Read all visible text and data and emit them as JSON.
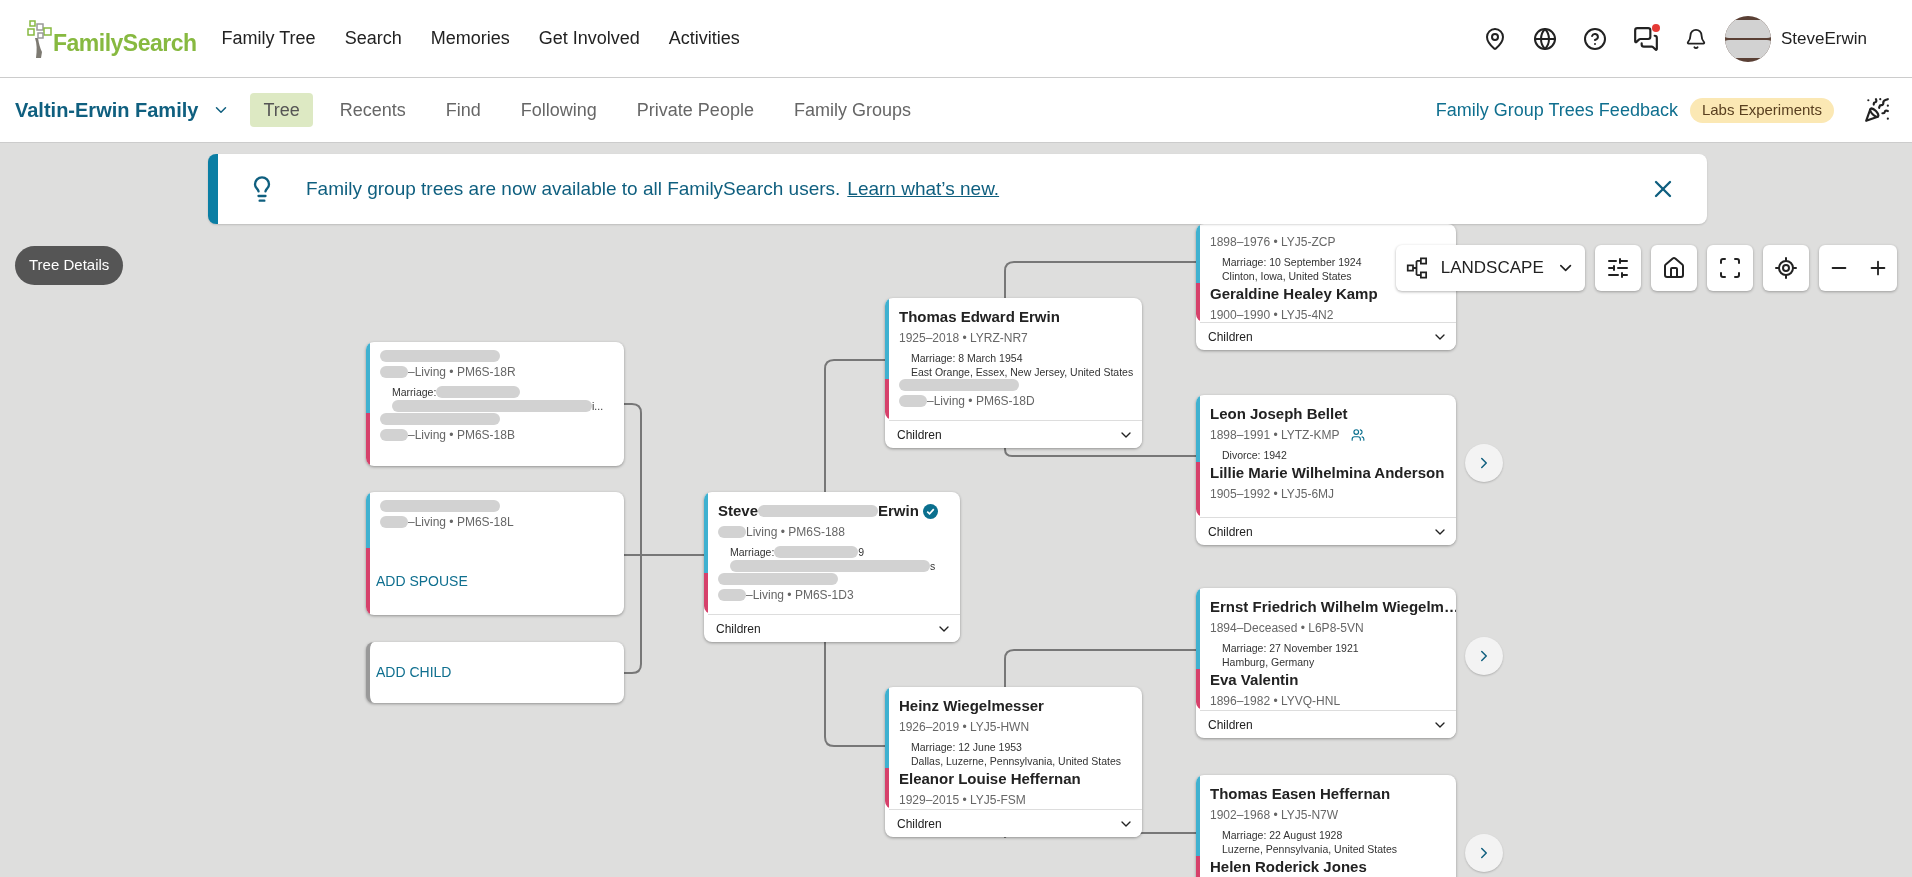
{
  "header": {
    "logo": "FamilySearch",
    "nav": [
      "Family Tree",
      "Search",
      "Memories",
      "Get Involved",
      "Activities"
    ],
    "messages_unread": true,
    "user": "SteveErwin"
  },
  "subnav": {
    "family": "Valtin-Erwin Family",
    "tabs": [
      {
        "label": "Tree",
        "selected": true
      },
      {
        "label": "Recents",
        "selected": false
      },
      {
        "label": "Find",
        "selected": false
      },
      {
        "label": "Following",
        "selected": false
      },
      {
        "label": "Private People",
        "selected": false
      },
      {
        "label": "Family Groups",
        "selected": false
      }
    ],
    "feedback_link": "Family Group Trees Feedback",
    "badge": "Labs Experiments"
  },
  "banner": {
    "text": "Family group trees are now available to all FamilySearch users.",
    "link": "Learn what’s new."
  },
  "tree_details": "Tree Details",
  "view_controls": {
    "layout": "LANDSCAPE"
  },
  "cards": [
    {
      "kind": "couple",
      "persons": [
        {
          "color": "#3fb1d0",
          "name": {
            "redacted": true
          },
          "lifespan": {
            "redacted": true,
            "tail": "–Living • PM6S-18R"
          }
        },
        {
          "color": "#d6416b",
          "name": {
            "redacted": true
          },
          "lifespan": {
            "redacted": true,
            "tail": "–Living • PM6S-18B"
          }
        }
      ],
      "event": {
        "text": "Marriage:",
        "redacted": true
      },
      "place": {
        "redacted": true,
        "tail": "i..."
      }
    },
    {
      "kind": "single",
      "persons": [
        {
          "color": "#3fb1d0",
          "name": {
            "redacted": true
          },
          "lifespan": {
            "redacted": true,
            "tail": "–Living • PM6S-18L"
          }
        }
      ],
      "add_spouse": "ADD SPOUSE"
    },
    {
      "kind": "add_child",
      "label": "ADD CHILD"
    },
    {
      "kind": "couple",
      "persons": [
        {
          "color": "#3fb1d0",
          "verified": true,
          "name": {
            "text": "Steve",
            "redacted": true,
            "tail": "Erwin"
          },
          "lifespan": {
            "redacted": true,
            "tail": "Living • PM6S-188"
          }
        },
        {
          "color": "#d6416b",
          "name": {
            "redacted": true
          },
          "lifespan": {
            "redacted": true,
            "tail": "–Living • PM6S-1D3"
          }
        }
      ],
      "event": {
        "text": "Marriage:",
        "redacted": true,
        "tail": "9"
      },
      "place": {
        "redacted": true,
        "tail": "s"
      },
      "children": "Children"
    },
    {
      "kind": "couple",
      "persons": [
        {
          "color": "#3fb1d0",
          "name": {
            "text": "Thomas Edward Erwin"
          },
          "lifespan": {
            "text": "1925–2018 • LYRZ-NR7"
          }
        },
        {
          "color": "#d6416b",
          "name": {
            "redacted": true
          },
          "lifespan": {
            "redacted": true,
            "tail": "–Living • PM6S-18D"
          }
        }
      ],
      "event": {
        "text": "Marriage: 8 March 1954"
      },
      "place": {
        "text": "East Orange, Essex, New Jersey, United States"
      },
      "children": "Children"
    },
    {
      "kind": "couple",
      "persons": [
        {
          "color": "#3fb1d0",
          "lifespan": {
            "text": "1898–1976 • LYJ5-ZCP"
          }
        },
        {
          "color": "#d6416b",
          "name": {
            "text": "Geraldine Healey Kamp"
          },
          "lifespan": {
            "text": "1900–1990 • LYJ5-4N2"
          }
        }
      ],
      "event": {
        "text": "Marriage: 10 September 1924"
      },
      "place": {
        "text": "Clinton, Iowa, United States"
      },
      "children": "Children"
    },
    {
      "kind": "couple",
      "more": true,
      "persons": [
        {
          "color": "#3fb1d0",
          "linked": true,
          "name": {
            "text": "Leon Joseph Bellet"
          },
          "lifespan": {
            "text": "1898–1991 • LYTZ-KMP"
          }
        },
        {
          "color": "#d6416b",
          "name": {
            "text": "Lillie Marie Wilhelmina Anderson"
          },
          "lifespan": {
            "text": "1905–1992 • LYJ5-6MJ"
          }
        }
      ],
      "event": {
        "text": "Divorce: 1942"
      },
      "children": "Children"
    },
    {
      "kind": "couple",
      "persons": [
        {
          "color": "#3fb1d0",
          "name": {
            "text": "Heinz Wiegelmesser"
          },
          "lifespan": {
            "text": "1926–2019 • LYJ5-HWN"
          }
        },
        {
          "color": "#d6416b",
          "name": {
            "text": "Eleanor Louise Heffernan"
          },
          "lifespan": {
            "text": "1929–2015 • LYJ5-FSM"
          }
        }
      ],
      "event": {
        "text": "Marriage: 12 June 1953"
      },
      "place": {
        "text": "Dallas, Luzerne, Pennsylvania, United States"
      },
      "children": "Children"
    },
    {
      "kind": "couple",
      "more": true,
      "persons": [
        {
          "color": "#3fb1d0",
          "name": {
            "text": "Ernst Friedrich Wilhelm Wiegelm…"
          },
          "lifespan": {
            "text": "1894–Deceased • L6P8-5VN"
          }
        },
        {
          "color": "#d6416b",
          "name": {
            "text": "Eva Valentin"
          },
          "lifespan": {
            "text": "1896–1982 • LYVQ-HNL"
          }
        }
      ],
      "event": {
        "text": "Marriage: 27 November 1921"
      },
      "place": {
        "text": "Hamburg, Germany"
      },
      "children": "Children"
    },
    {
      "kind": "couple",
      "more": true,
      "persons": [
        {
          "color": "#3fb1d0",
          "name": {
            "text": "Thomas Easen Heffernan"
          },
          "lifespan": {
            "text": "1902–1968 • LYJ5-N7W"
          }
        },
        {
          "color": "#d6416b",
          "name": {
            "text": "Helen Roderick Jones"
          }
        }
      ],
      "event": {
        "text": "Marriage: 22 August 1928"
      },
      "place": {
        "text": "Luzerne, Pennsylvania, United States"
      }
    }
  ]
}
